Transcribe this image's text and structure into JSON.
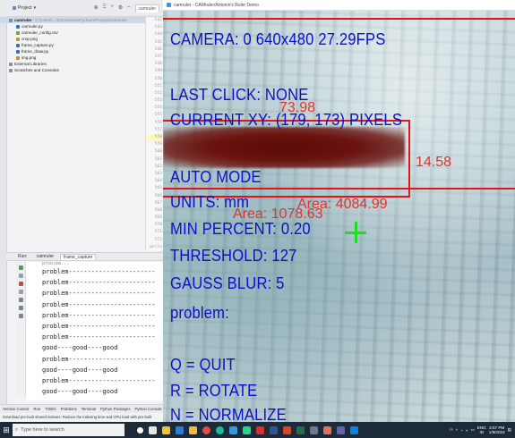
{
  "ide": {
    "project_tab": "Project",
    "editor_tab": "camruler",
    "tree": [
      {
        "label": "camruler",
        "path": "C:\\Users\\...\\Documents\\PycharmProjects\\camruler",
        "icon": "folder-icon",
        "selected": true
      },
      {
        "label": "camruler.py",
        "icon": "python-file-icon"
      },
      {
        "label": "camruler_config.csv",
        "icon": "csv-file-icon"
      },
      {
        "label": "crop.png",
        "icon": "image-file-icon"
      },
      {
        "label": "frame_capture.py",
        "icon": "python-file-icon"
      },
      {
        "label": "frame_draw.py",
        "icon": "python-file-icon"
      },
      {
        "label": "img.png",
        "icon": "image-file-icon"
      },
      {
        "label": "External Libraries",
        "icon": "library-icon"
      },
      {
        "label": "Scratches and Consoles",
        "icon": "scratch-icon"
      }
    ],
    "line_numbers": [
      "542",
      "543",
      "544",
      "545",
      "546",
      "547",
      "548",
      "549",
      "550",
      "551",
      "552",
      "553",
      "554",
      "555",
      "556",
      "557",
      "558",
      "559",
      "560",
      "561",
      "562",
      "563",
      "564",
      "565",
      "566",
      "567",
      "568",
      "569",
      "570",
      "571",
      "572",
      "while 1"
    ],
    "run_tabs": [
      "Run:",
      "camruler",
      "frame_capture"
    ],
    "output_lines": [
      "problem...",
      "problem-----------------------",
      "problem-----------------------",
      "problem-----------------------",
      "problem-----------------------",
      "problem-----------------------",
      "problem-----------------------",
      "problem-----------------------",
      "good----good----good",
      "problem-----------------------",
      "good----good----good",
      "problem-----------------------",
      "good----good----good"
    ],
    "bottom_tabs": [
      "Version Control",
      "Run",
      "TODO",
      "Problems",
      "Terminal",
      "Python Packages",
      "Python Console"
    ],
    "status_text": "Download pre-built shared indexes: Reduce the indexing time and CPU load with pre-built"
  },
  "camera": {
    "window_title": "camruler - CAMruler/Antonin's Ruler Demo",
    "header": "CAMERA: 0 640x480 27.29FPS",
    "last_click": "LAST CLICK: NONE",
    "current_xy": "CURRENT XY: (179, 173) PIXELS",
    "auto_mode": "AUTO MODE",
    "units": "UNITS: mm",
    "min_percent": "MIN PERCENT: 0.20",
    "threshold": "THRESHOLD: 127",
    "gauss_blur": "GAUSS BLUR: 5",
    "problem": "problem:",
    "quit": "Q = QUIT",
    "rotate": "R = ROTATE",
    "normalize": "N = NORMALIZE",
    "measure_top": "73.98",
    "measure_right": "14.58",
    "area_small": "Area: 1078.63",
    "area_large": "Area: 4084.99",
    "text_color": "#0a10c8",
    "box_color": "#e0141c",
    "crosshair_color": "#1edd22"
  },
  "taskbar": {
    "search_placeholder": "Type here to search",
    "time": "4:57 PM",
    "date": "1/9/2024",
    "lang": "ENG",
    "region": "IN"
  }
}
